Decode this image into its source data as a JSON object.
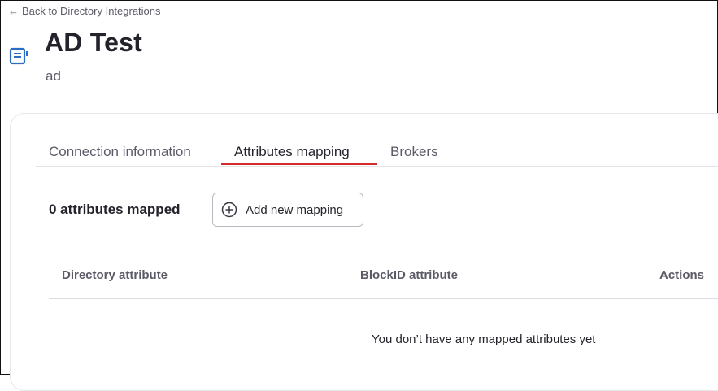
{
  "nav": {
    "back_label": "Back to Directory Integrations"
  },
  "header": {
    "title": "AD Test",
    "subtitle": "ad",
    "icon": "directory-book-icon"
  },
  "tabs": [
    {
      "label": "Connection information",
      "active": false
    },
    {
      "label": "Attributes mapping",
      "active": true
    },
    {
      "label": "Brokers",
      "active": false
    }
  ],
  "mapping": {
    "count_label": "0 attributes mapped",
    "add_button_label": "Add new mapping",
    "add_button_icon": "plus-circle-icon"
  },
  "table": {
    "columns": [
      "Directory attribute",
      "BlockID attribute",
      "Actions"
    ],
    "rows": [],
    "empty_message": "You don’t have any mapped attributes yet"
  },
  "colors": {
    "accent": "#d32a2a",
    "icon_blue": "#2e6dc4",
    "text_primary": "#24222b"
  }
}
